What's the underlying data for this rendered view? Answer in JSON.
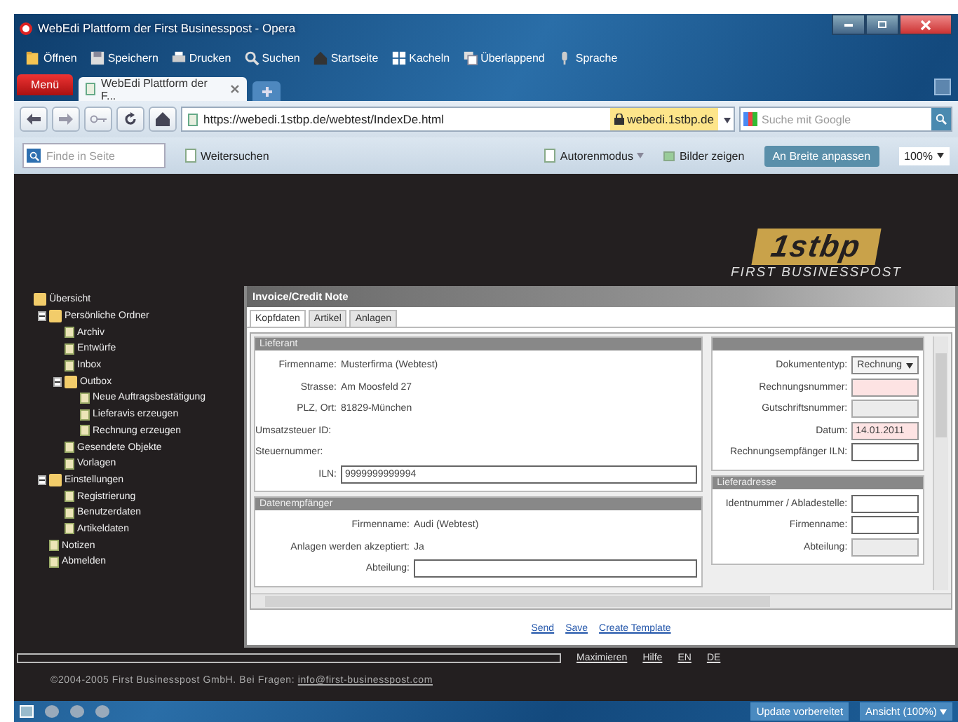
{
  "window": {
    "title": "WebEdi Plattform der First Businesspost - Opera"
  },
  "toolbar": [
    {
      "label": "Öffnen"
    },
    {
      "label": "Speichern"
    },
    {
      "label": "Drucken"
    },
    {
      "label": "Suchen"
    },
    {
      "label": "Startseite"
    },
    {
      "label": "Kacheln"
    },
    {
      "label": "Überlappend"
    },
    {
      "label": "Sprache"
    }
  ],
  "menu_button": "Menü",
  "tabs": [
    {
      "label": "WebEdi Plattform der F...",
      "selected": true
    }
  ],
  "address": {
    "url": "https://webedi.1stbp.de/webtest/IndexDe.html",
    "site": "webedi.1stbp.de",
    "search_placeholder": "Suche mit Google"
  },
  "findbar": {
    "placeholder": "Finde in Seite",
    "next": "Weitersuchen",
    "author_mode": "Autorenmodus",
    "show_images": "Bilder zeigen",
    "fit_width": "An Breite anpassen",
    "zoom": "100%"
  },
  "logo": {
    "mark": "1stbp",
    "tagline": "FIRST BUSINESSPOST"
  },
  "tree": [
    {
      "label": "Übersicht",
      "kind": "folder",
      "children": [
        {
          "label": "Persönliche Ordner",
          "kind": "folder",
          "expanded": true,
          "children": [
            {
              "label": "Archiv",
              "kind": "page"
            },
            {
              "label": "Entwürfe",
              "kind": "page"
            },
            {
              "label": "Inbox",
              "kind": "page"
            },
            {
              "label": "Outbox",
              "kind": "folder",
              "expanded": true,
              "children": [
                {
                  "label": "Neue Auftragsbestätigung",
                  "kind": "page"
                },
                {
                  "label": "Lieferavis erzeugen",
                  "kind": "page"
                },
                {
                  "label": "Rechnung erzeugen",
                  "kind": "page"
                }
              ]
            },
            {
              "label": "Gesendete Objekte",
              "kind": "page"
            },
            {
              "label": "Vorlagen",
              "kind": "page"
            }
          ]
        },
        {
          "label": "Einstellungen",
          "kind": "folder",
          "expanded": true,
          "children": [
            {
              "label": "Registrierung",
              "kind": "page"
            },
            {
              "label": "Benutzerdaten",
              "kind": "page"
            },
            {
              "label": "Artikeldaten",
              "kind": "page"
            }
          ]
        },
        {
          "label": "Notizen",
          "kind": "page"
        },
        {
          "label": "Abmelden",
          "kind": "page"
        }
      ]
    }
  ],
  "panel": {
    "title": "Invoice/Credit Note",
    "tabs": [
      {
        "label": "Kopfdaten",
        "selected": true
      },
      {
        "label": "Artikel",
        "selected": false
      },
      {
        "label": "Anlagen",
        "selected": false
      }
    ],
    "sections": [
      {
        "title": "Lieferant",
        "rows": [
          {
            "label": "Firmenname:",
            "kind": "text",
            "value": "Musterfirma (Webtest)"
          },
          {
            "label": "Strasse:",
            "kind": "text",
            "value": "Am Moosfeld 27"
          },
          {
            "label": "PLZ, Ort:",
            "kind": "text",
            "value": "81829-München"
          },
          {
            "label": "Umsatzsteuer ID:",
            "kind": "text",
            "value": ""
          },
          {
            "label": "Steuernummer:",
            "kind": "text",
            "value": ""
          },
          {
            "label": "ILN:",
            "kind": "input",
            "value": "9999999999994",
            "highlighted": false,
            "disabled": false
          }
        ]
      },
      {
        "rows": [
          {
            "label": "Dokumententyp:",
            "kind": "select",
            "value": "Rechnung"
          },
          {
            "label": "Rechnungsnummer:",
            "kind": "input",
            "value": "",
            "highlighted": true,
            "disabled": false
          },
          {
            "label": "Gutschriftsnummer:",
            "kind": "input",
            "value": "",
            "highlighted": false,
            "disabled": true
          },
          {
            "label": "Datum:",
            "kind": "input",
            "value": "14.01.2011",
            "highlighted": true,
            "disabled": false
          },
          {
            "label": "Rechnungsempfänger ILN:",
            "kind": "input",
            "value": "",
            "highlighted": false,
            "disabled": false
          }
        ]
      },
      {
        "title": "Datenempfänger",
        "rows": [
          {
            "label": "Firmenname:",
            "kind": "text",
            "value": "Audi (Webtest)"
          },
          {
            "label": "Anlagen werden akzeptiert:",
            "kind": "text",
            "value": "Ja"
          },
          {
            "label": "Abteilung:",
            "kind": "input",
            "value": "",
            "highlighted": false,
            "disabled": false
          }
        ]
      },
      {
        "title": "Lieferadresse",
        "rows": [
          {
            "label": "Identnummer / Abladestelle:",
            "kind": "input",
            "value": "",
            "highlighted": false,
            "disabled": false
          },
          {
            "label": "Firmenname:",
            "kind": "input",
            "value": "",
            "highlighted": false,
            "disabled": false
          },
          {
            "label": "Abteilung:",
            "kind": "input",
            "value": "",
            "highlighted": false,
            "disabled": true
          }
        ]
      }
    ],
    "actions": [
      "Send",
      "Save",
      "Create Template"
    ]
  },
  "footer": {
    "links": [
      "Maximieren",
      "Hilfe",
      "EN",
      "DE"
    ],
    "copyright": "©2004-2005 First Businesspost GmbH. Bei Fragen: ",
    "email": "info@first-businesspost.com"
  },
  "status_bar": {
    "update": "Update vorbereitet",
    "view": "Ansicht (100%)"
  }
}
